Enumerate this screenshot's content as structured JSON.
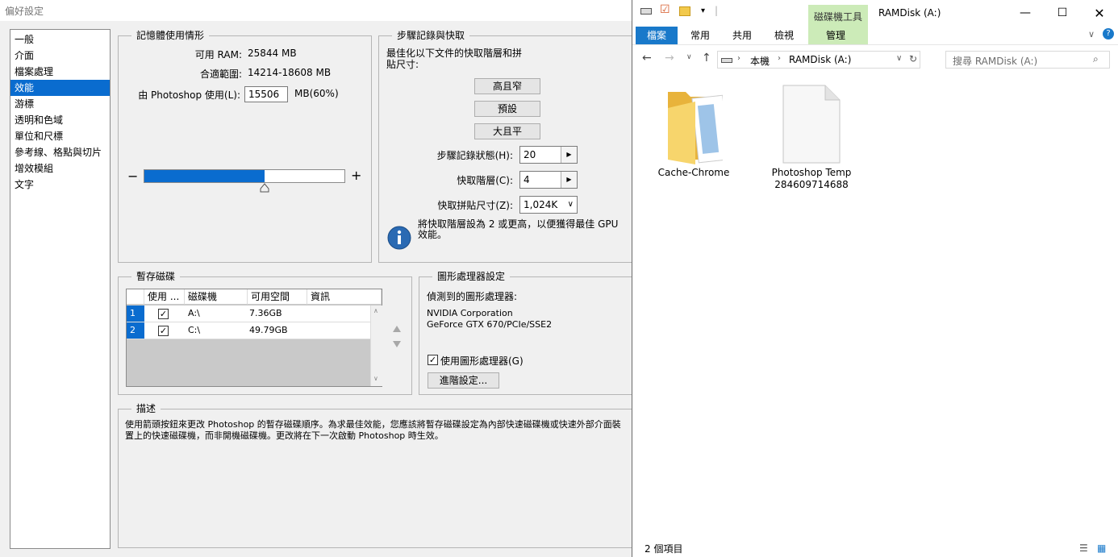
{
  "ps": {
    "title": "偏好設定",
    "nav": [
      "一般",
      "介面",
      "檔案處理",
      "效能",
      "游標",
      "透明和色域",
      "單位和尺標",
      "參考線、格點與切片",
      "增效模組",
      "文字"
    ],
    "nav_selected": 3,
    "memory": {
      "title": "記憶體使用情形",
      "available_label": "可用 RAM:",
      "available_value": "25844 MB",
      "ideal_label": "合適範圍:",
      "ideal_value": "14214-18608 MB",
      "use_label": "由 Photoshop 使用(L):",
      "use_value": "15506",
      "use_unit": "MB(60%)",
      "minus": "−",
      "plus": "+",
      "slider_percent": 60
    },
    "history": {
      "title": "步驟記錄與快取",
      "optimize_text": "最佳化以下文件的快取階層和拼貼尺寸:",
      "btn_tall": "高且窄",
      "btn_default": "預設",
      "btn_big": "大且平",
      "states_label": "步驟記錄狀態(H):",
      "states_value": "20",
      "levels_label": "快取階層(C):",
      "levels_value": "4",
      "tile_label": "快取拼貼尺寸(Z):",
      "tile_value": "1,024K",
      "info": "將快取階層設為 2 或更高，以便獲得最佳 GPU 效能。"
    },
    "scratch": {
      "title": "暫存磁碟",
      "headers": [
        "使用 ...",
        "磁碟機",
        "可用空間",
        "資訊"
      ],
      "rows": [
        {
          "num": "1",
          "checked": true,
          "drive": "A:\\",
          "free": "7.36GB",
          "info": ""
        },
        {
          "num": "2",
          "checked": true,
          "drive": "C:\\",
          "free": "49.79GB",
          "info": ""
        }
      ],
      "checkmark": "✓"
    },
    "gpu": {
      "title": "圖形處理器設定",
      "detected": "偵測到的圖形處理器:",
      "vendor": "NVIDIA Corporation",
      "model": "GeForce GTX 670/PCIe/SSE2",
      "use_label": "使用圖形處理器(G)",
      "advanced": "進階設定..."
    },
    "desc": {
      "title": "描述",
      "text": "使用箭頭按鈕來更改 Photoshop 的暫存磁碟順序。為求最佳效能，您應該將暫存磁碟設定為內部快速磁碟機或快速外部介面裝置上的快速磁碟機，而非開機磁碟機。更改將在下一次啟動 Photoshop 時生效。"
    }
  },
  "explorer": {
    "title": "RAMDisk (A:)",
    "ribbon_context": "磁碟機工具",
    "tabs": [
      "檔案",
      "常用",
      "共用",
      "檢視",
      "管理"
    ],
    "address": [
      "本機",
      "RAMDisk (A:)"
    ],
    "search_placeholder": "搜尋 RAMDisk (A:)",
    "items": [
      {
        "name": "Cache-Chrome",
        "type": "folder"
      },
      {
        "name": "Photoshop Temp284609714688",
        "type": "file"
      }
    ],
    "status": "2 個項目",
    "colors": {
      "accent": "#1979ca",
      "context": "#ccebb8",
      "selection": "#0a6ccf"
    }
  }
}
